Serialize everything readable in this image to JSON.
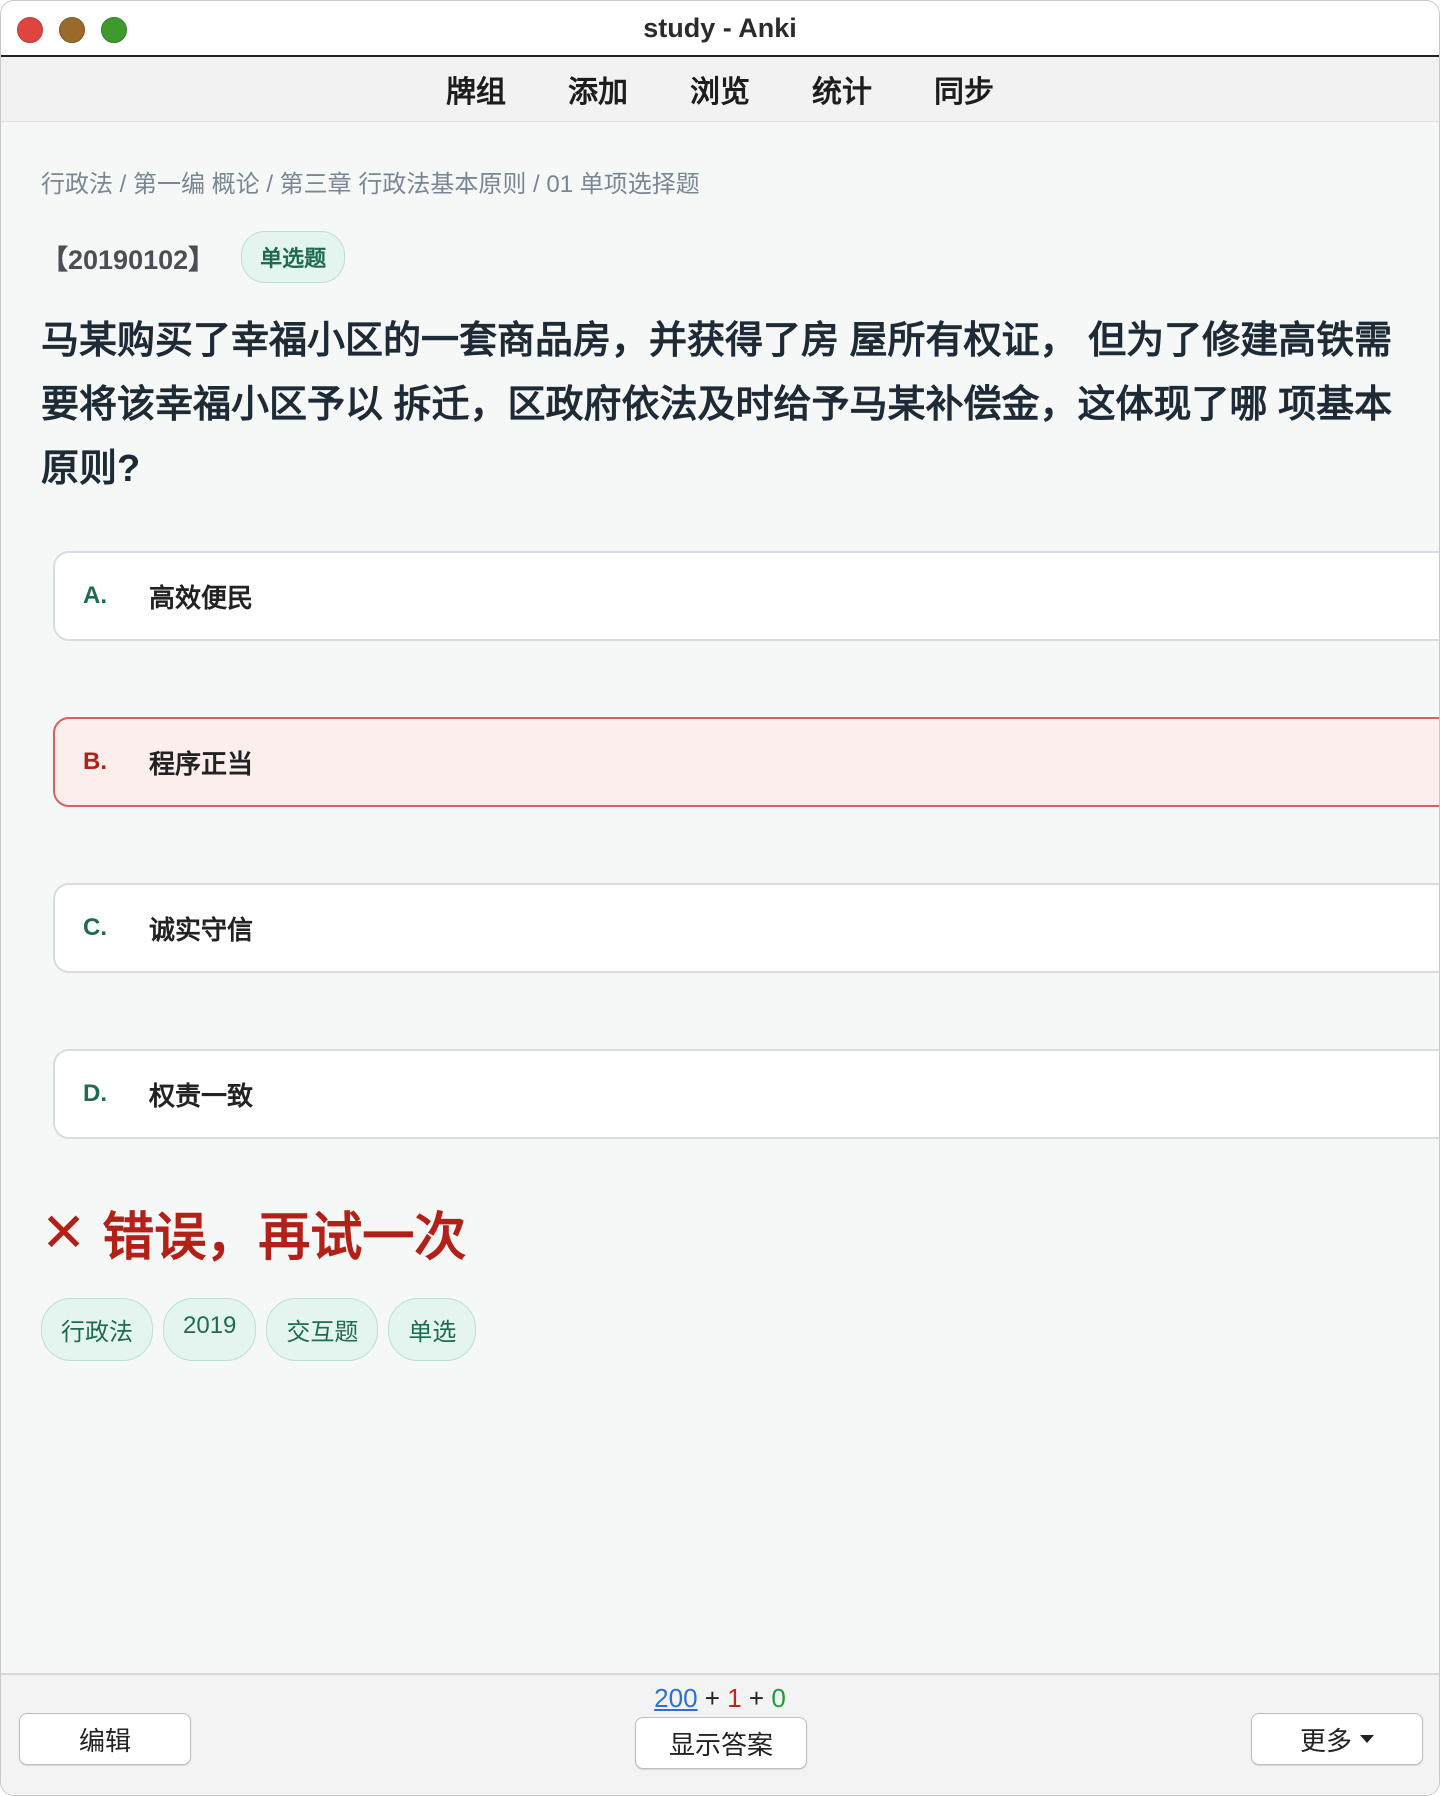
{
  "window": {
    "title": "study - Anki"
  },
  "nav": [
    "牌组",
    "添加",
    "浏览",
    "统计",
    "同步"
  ],
  "card": {
    "breadcrumb": "行政法 / 第一编 概论 / 第三章 行政法基本原则 / 01 单项选择题",
    "id": "【20190102】",
    "type_badge": "单选题",
    "question": "马某购买了幸福小区的一套商品房，并获得了房 屋所有权证， 但为了修建高铁需要将该幸福小区予以 拆迁，区政府依法及时给予马某补偿金，这体现了哪 项基本原则?",
    "options": [
      {
        "letter": "A.",
        "text": "高效便民"
      },
      {
        "letter": "B.",
        "text": "程序正当"
      },
      {
        "letter": "C.",
        "text": "诚实守信"
      },
      {
        "letter": "D.",
        "text": "权责一致"
      }
    ],
    "feedback": {
      "icon": "✕",
      "text": "错误，再试一次"
    },
    "tags": [
      "行政法",
      "2019",
      "交互题",
      "单选"
    ]
  },
  "bottom": {
    "counts": {
      "new": "200",
      "learn": "1",
      "review": "0",
      "sep": "+"
    },
    "edit_label": "编辑",
    "show_answer_label": "显示答案",
    "more_label": "更多"
  }
}
